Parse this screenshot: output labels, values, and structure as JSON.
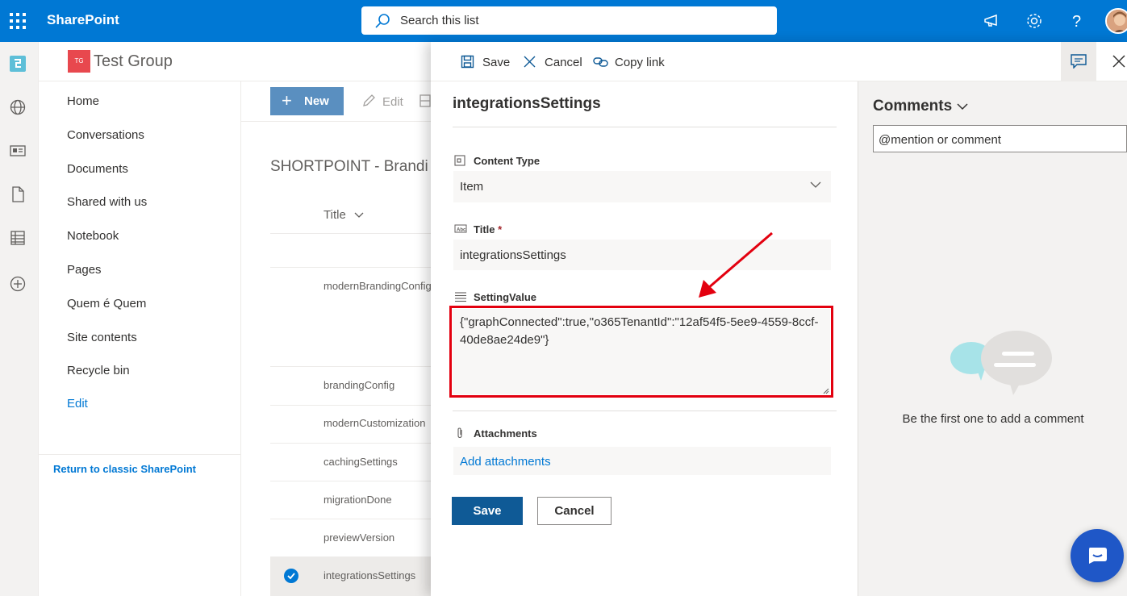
{
  "suite": {
    "brand": "SharePoint",
    "search_placeholder": "Search this list"
  },
  "site": {
    "logo_initials": "TG",
    "title": "Test Group"
  },
  "nav": {
    "items": [
      "Home",
      "Conversations",
      "Documents",
      "Shared with us",
      "Notebook",
      "Pages",
      "Quem é Quem",
      "Site contents",
      "Recycle bin"
    ],
    "edit_label": "Edit",
    "classic_link": "Return to classic SharePoint"
  },
  "list": {
    "new_label": "New",
    "edit_label": "Edit",
    "title": "SHORTPOINT - Brandi",
    "column_title": "Title",
    "rows": [
      "modernBrandingConfig",
      "brandingConfig",
      "modernCustomization",
      "cachingSettings",
      "migrationDone",
      "previewVersion",
      "integrationsSettings"
    ]
  },
  "panel": {
    "toolbar": {
      "save": "Save",
      "cancel": "Cancel",
      "copy_link": "Copy link"
    },
    "form_title": "integrationsSettings",
    "fields": {
      "content_type": {
        "label": "Content Type",
        "value": "Item"
      },
      "title": {
        "label": "Title",
        "required_mark": "*",
        "value": "integrationsSettings"
      },
      "setting_value": {
        "label": "SettingValue",
        "value": "{\"graphConnected\":true,\"o365TenantId\":\"12af54f5-5ee9-4559-8ccf-40de8ae24de9\"}"
      },
      "attachments": {
        "label": "Attachments",
        "add_label": "Add attachments"
      }
    },
    "buttons": {
      "save": "Save",
      "cancel": "Cancel"
    }
  },
  "comments": {
    "title": "Comments",
    "input_placeholder": "@mention or comment",
    "empty_message": "Be the first one to add a comment"
  },
  "colors": {
    "suite_blue": "#0078d4",
    "primary_button": "#0f5a96",
    "annotation_red": "#e3000f"
  }
}
